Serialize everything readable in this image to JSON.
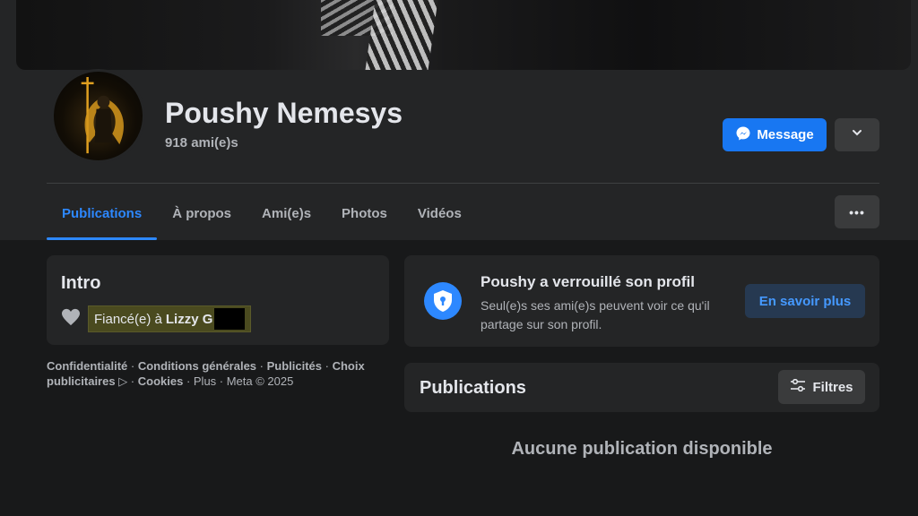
{
  "profile": {
    "name": "Poushy Nemesys",
    "friends_count": "918 ami(e)s"
  },
  "actions": {
    "message_label": "Message"
  },
  "tabs": [
    {
      "label": "Publications",
      "active": true
    },
    {
      "label": "À propos",
      "active": false
    },
    {
      "label": "Ami(e)s",
      "active": false
    },
    {
      "label": "Photos",
      "active": false
    },
    {
      "label": "Vidéos",
      "active": false
    }
  ],
  "more_label": "•••",
  "intro": {
    "title": "Intro",
    "relationship_prefix": "Fiancé(e) à",
    "relationship_name": "Lizzy G"
  },
  "footer": {
    "links": [
      "Confidentialité",
      "Conditions générales",
      "Publicités",
      "Choix publicitaires ▷",
      "Cookies"
    ],
    "rest": "Plus · Meta © 2025"
  },
  "locked": {
    "title": "Poushy a verrouillé son profil",
    "description": "Seul(e)s ses ami(e)s peuvent voir ce qu'il partage sur son profil.",
    "learn_more_label": "En savoir plus"
  },
  "posts": {
    "title": "Publications",
    "filters_label": "Filtres",
    "empty_text": "Aucune publication disponible"
  },
  "colors": {
    "accent": "#2d88ff",
    "message_button": "#1877f2",
    "background": "#18191a",
    "card": "#242526"
  }
}
